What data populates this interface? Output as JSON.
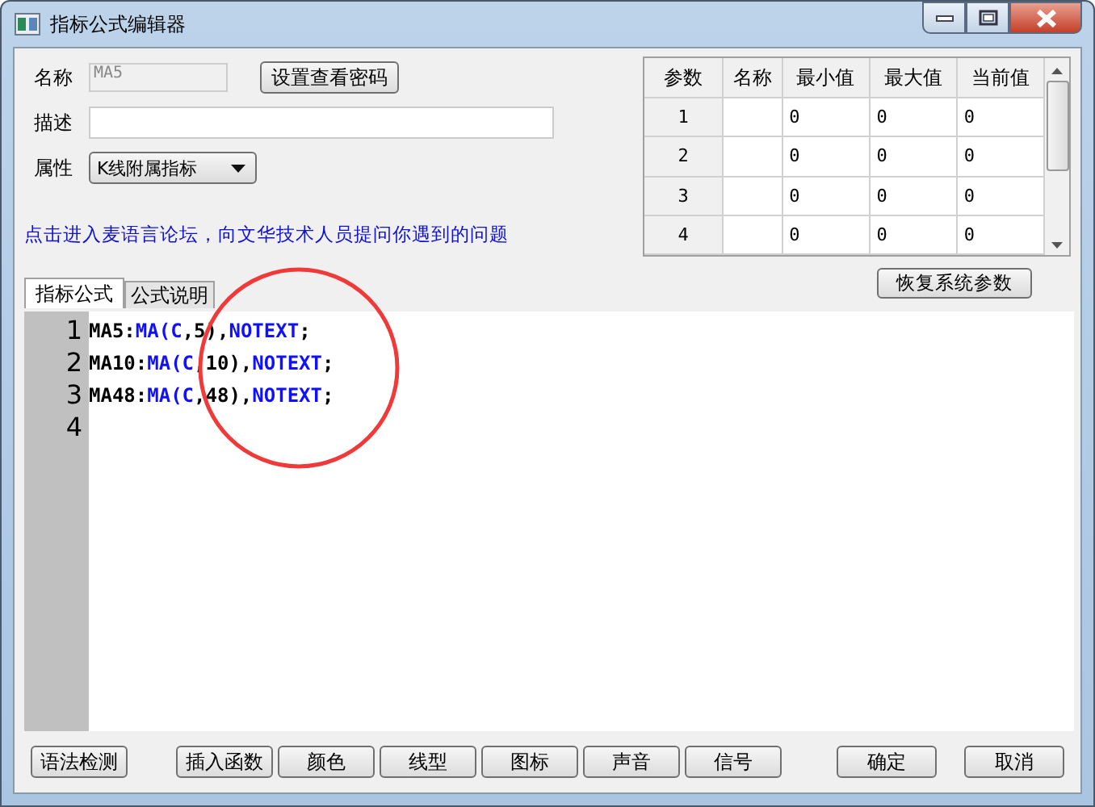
{
  "window": {
    "title": "指标公式编辑器"
  },
  "form": {
    "name_label": "名称",
    "name_value": "MA5",
    "password_button": "设置查看密码",
    "desc_label": "描述",
    "attr_label": "属性",
    "attr_value": "K线附属指标"
  },
  "params_table": {
    "columns": [
      "参数",
      "名称",
      "最小值",
      "最大值",
      "当前值"
    ],
    "rows": [
      {
        "cells": [
          "1",
          "",
          "0",
          "0",
          "0"
        ]
      },
      {
        "cells": [
          "2",
          "",
          "0",
          "0",
          "0"
        ]
      },
      {
        "cells": [
          "3",
          "",
          "0",
          "0",
          "0"
        ]
      },
      {
        "cells": [
          "4",
          "",
          "0",
          "0",
          "0"
        ]
      }
    ]
  },
  "forum_link": "点击进入麦语言论坛，向文华技术人员提问你遇到的问题",
  "restore_button": "恢复系统参数",
  "tabs": [
    {
      "label": "指标公式",
      "selected": true
    },
    {
      "label": "公式说明",
      "selected": false
    }
  ],
  "editor": {
    "lines": [
      {
        "number": "1",
        "tokens": [
          {
            "text": "MA5:",
            "kind": "plain"
          },
          {
            "text": "MA(C",
            "kind": "func"
          },
          {
            "text": ",5),",
            "kind": "plain"
          },
          {
            "text": "NOTEXT",
            "kind": "func"
          },
          {
            "text": ";",
            "kind": "plain"
          }
        ]
      },
      {
        "number": "2",
        "tokens": [
          {
            "text": "MA10:",
            "kind": "plain"
          },
          {
            "text": "MA(C",
            "kind": "func"
          },
          {
            "text": ",10),",
            "kind": "plain"
          },
          {
            "text": "NOTEXT",
            "kind": "func"
          },
          {
            "text": ";",
            "kind": "plain"
          }
        ]
      },
      {
        "number": "3",
        "tokens": [
          {
            "text": "MA48:",
            "kind": "plain"
          },
          {
            "text": "MA(C",
            "kind": "func"
          },
          {
            "text": ",48),",
            "kind": "plain"
          },
          {
            "text": "NOTEXT",
            "kind": "func"
          },
          {
            "text": ";",
            "kind": "plain"
          }
        ]
      },
      {
        "number": "4"
      }
    ]
  },
  "left_buttons": [
    "语法检测"
  ],
  "middle_buttons": [
    "插入函数",
    "颜色",
    "线型",
    "图标",
    "声音",
    "信号"
  ],
  "right_buttons": [
    "确定",
    "取消"
  ]
}
